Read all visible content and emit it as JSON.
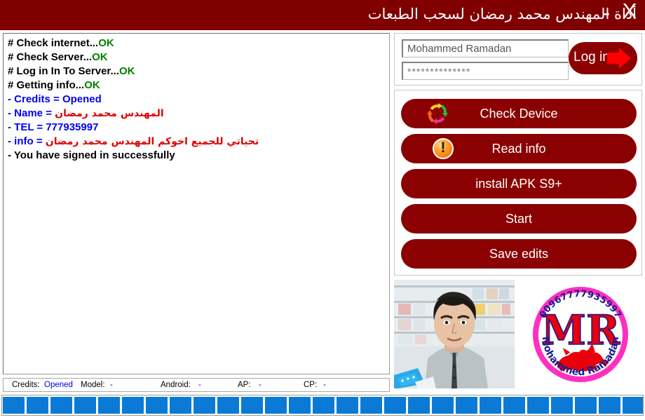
{
  "window": {
    "title": "أداة المهندس محمد رمضان لسحب الطبعات",
    "minimize_label": "-",
    "close_label": "X",
    "titlebar_color": "#800000"
  },
  "log": {
    "lines": [
      {
        "prefix": "# ",
        "text": "Check internet",
        "dots": "...",
        "status": "OK",
        "prefix_color": "#000000",
        "text_color": "#000000",
        "status_color": "#008000"
      },
      {
        "prefix": "# ",
        "text": "Check Server",
        "dots": "...",
        "status": "OK",
        "prefix_color": "#000000",
        "text_color": "#000000",
        "status_color": "#008000"
      },
      {
        "prefix": "# ",
        "text": "Log in In To Server",
        "dots": "...",
        "status": "OK",
        "prefix_color": "#000000",
        "text_color": "#000000",
        "status_color": "#008000"
      },
      {
        "prefix": "# ",
        "text": "Getting info",
        "dots": "...",
        "status": "OK",
        "prefix_color": "#000000",
        "text_color": "#000000",
        "status_color": "#008000"
      },
      {
        "prefix": "- ",
        "text": "Credits = Opened",
        "dots": "",
        "status": "",
        "prefix_color": "#0000ee",
        "text_color": "#0000ee",
        "status_color": "#0000ee"
      },
      {
        "prefix": "- ",
        "text": "Name = ",
        "dots": "",
        "status": "المهندس محمد رمضان",
        "prefix_color": "#0000ee",
        "text_color": "#0000ee",
        "status_color": "#e00000"
      },
      {
        "prefix": "- ",
        "text": "TEL = 777935997",
        "dots": "",
        "status": "",
        "prefix_color": "#0000ee",
        "text_color": "#0000ee",
        "status_color": "#0000ee"
      },
      {
        "prefix": "- ",
        "text": "info = ",
        "dots": "",
        "status": "تحياتي للجميع اخوكم المهندس محمد رمضان",
        "prefix_color": "#0000ee",
        "text_color": "#0000ee",
        "status_color": "#e00000"
      },
      {
        "prefix": "- ",
        "text": "You have signed in successfully",
        "dots": "",
        "status": "",
        "prefix_color": "#000000",
        "text_color": "#000000",
        "status_color": "#000000"
      }
    ]
  },
  "statusbar": {
    "credits_label": "Credits:",
    "credits_value": "Opened",
    "model_label": "Model:",
    "model_value": "-",
    "android_label": "Android:",
    "android_value": "-",
    "ap_label": "AP:",
    "ap_value": "-",
    "cp_label": "CP:",
    "cp_value": "-"
  },
  "login": {
    "username_value": "Mohammed Ramadan",
    "username_placeholder": "Mohammed Ramadan",
    "password_value": "**************",
    "password_placeholder": "**************",
    "login_label": "Log in",
    "login_icon": "arrow-right-icon"
  },
  "actions": {
    "buttons": [
      {
        "label": "Check Device",
        "icon": "refresh-cycle-icon",
        "color": "#8b0000"
      },
      {
        "label": "Read info",
        "icon": "warning-circle-icon",
        "color": "#8b0000"
      },
      {
        "label": "install APK S9+",
        "icon": "",
        "color": "#8b0000"
      },
      {
        "label": "Start",
        "icon": "",
        "color": "#8b0000"
      },
      {
        "label": "Save edits",
        "icon": "",
        "color": "#8b0000"
      }
    ]
  },
  "branding": {
    "photo_alt": "developer-portrait",
    "logo_initials": "MR",
    "logo_top_text": "00967777935997",
    "logo_bottom_text": "Mohammed Ramadan",
    "logo_ring_color": "#ff2fc0",
    "logo_text_color": "#e8000c"
  },
  "progress": {
    "percent": 100,
    "segment_color": "#0a7ad6",
    "segments": 28
  }
}
